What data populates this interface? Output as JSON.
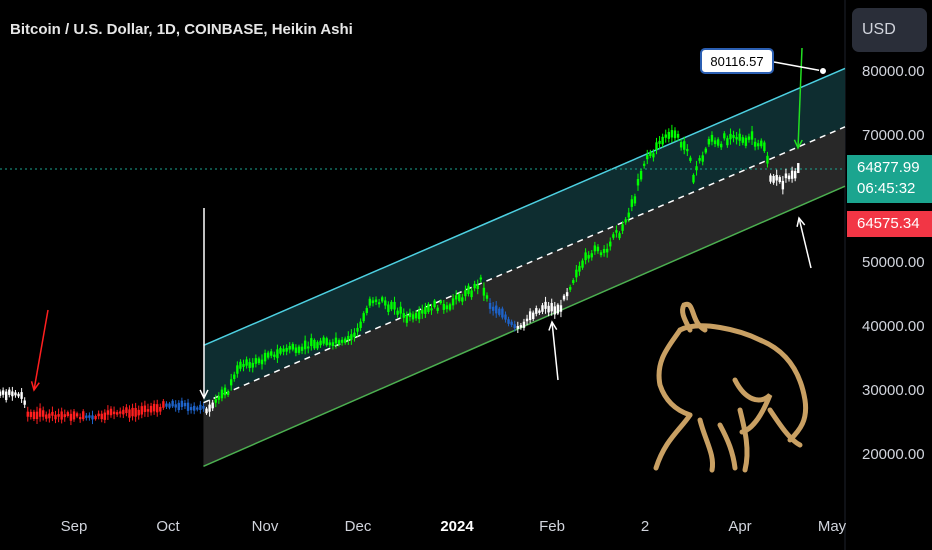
{
  "header": {
    "title": "Bitcoin / U.S. Dollar, 1D, COINBASE, Heikin Ashi",
    "currency_label": "USD"
  },
  "price_scale": {
    "ticks": [
      "80000.00",
      "70000.00",
      "50000.00",
      "40000.00",
      "30000.00",
      "20000.00"
    ],
    "current_price": "64877.99",
    "countdown": "06:45:32",
    "lower_price": "64575.34"
  },
  "time_axis": {
    "labels": [
      "Sep",
      "Oct",
      "Nov",
      "Dec",
      "2024",
      "Feb",
      "2",
      "Apr",
      "May"
    ]
  },
  "annotation": {
    "target_value": "80116.57"
  },
  "colors": {
    "background": "#000000",
    "channel_upper": "#4dd0e1",
    "channel_lower": "#4caf50",
    "channel_mid": "#ffffff",
    "candle_green": "#00ff00",
    "candle_white": "#ffffff",
    "candle_red": "#ff1f1f",
    "candle_blue": "#1e63c9",
    "current_price_bg": "#1ba58f",
    "lower_price_bg": "#f23645",
    "logo_gold": "#c9a063"
  },
  "chart_data": {
    "type": "line",
    "y_scale_units": "USD",
    "ylim": [
      17000,
      88000
    ],
    "x_range": [
      "2023-07-27",
      "2024-05-15"
    ],
    "channel": {
      "start": "2023-10-13",
      "end": "2024-05-15",
      "upper": [
        37000,
        82000
      ],
      "mid": [
        28000,
        72800
      ],
      "lower": [
        18000,
        63500
      ]
    },
    "series": [
      {
        "points": [
          [
            "2023-07-27",
            29300,
            "white"
          ],
          [
            "2023-08-10",
            29400,
            "white"
          ],
          [
            "2023-08-15",
            29200,
            "white"
          ],
          [
            "2023-08-17",
            26200,
            "red"
          ],
          [
            "2023-08-25",
            26100,
            "red"
          ],
          [
            "2023-09-01",
            25900,
            "red"
          ],
          [
            "2023-09-05",
            25800,
            "blue"
          ],
          [
            "2023-09-08",
            25900,
            "red"
          ],
          [
            "2023-09-15",
            26600,
            "red"
          ],
          [
            "2023-09-22",
            26500,
            "red"
          ],
          [
            "2023-10-01",
            27500,
            "blue"
          ],
          [
            "2023-10-05",
            27600,
            "blue"
          ],
          [
            "2023-10-10",
            27300,
            "blue"
          ],
          [
            "2023-10-14",
            26900,
            "white"
          ],
          [
            "2023-10-17",
            28400,
            "green"
          ],
          [
            "2023-10-21",
            29800,
            "green"
          ],
          [
            "2023-10-24",
            33500,
            "green"
          ],
          [
            "2023-10-31",
            34500,
            "green"
          ],
          [
            "2023-11-09",
            36500,
            "green"
          ],
          [
            "2023-11-16",
            37000,
            "green"
          ],
          [
            "2023-11-23",
            37500,
            "green"
          ],
          [
            "2023-12-01",
            38500,
            "green"
          ],
          [
            "2023-12-06",
            43500,
            "green"
          ],
          [
            "2023-12-10",
            44000,
            "green"
          ],
          [
            "2023-12-18",
            41500,
            "green"
          ],
          [
            "2023-12-25",
            43000,
            "green"
          ],
          [
            "2024-01-01",
            43500,
            "green"
          ],
          [
            "2024-01-08",
            45500,
            "green"
          ],
          [
            "2024-01-11",
            47000,
            "green"
          ],
          [
            "2024-01-14",
            43000,
            "blue"
          ],
          [
            "2024-01-19",
            41500,
            "blue"
          ],
          [
            "2024-01-23",
            40000,
            "white"
          ],
          [
            "2024-01-26",
            41000,
            "white"
          ],
          [
            "2024-02-01",
            43000,
            "white"
          ],
          [
            "2024-02-05",
            42500,
            "white"
          ],
          [
            "2024-02-09",
            45500,
            "green"
          ],
          [
            "2024-02-14",
            51500,
            "green"
          ],
          [
            "2024-02-20",
            52000,
            "green"
          ],
          [
            "2024-02-27",
            56000,
            "green"
          ],
          [
            "2024-03-02",
            62000,
            "green"
          ],
          [
            "2024-03-05",
            66500,
            "green"
          ],
          [
            "2024-03-08",
            68000,
            "green"
          ],
          [
            "2024-03-13",
            71000,
            "green"
          ],
          [
            "2024-03-17",
            68500,
            "green"
          ],
          [
            "2024-03-20",
            64000,
            "green"
          ],
          [
            "2024-03-26",
            69500,
            "green"
          ],
          [
            "2024-04-01",
            69000,
            "green"
          ],
          [
            "2024-04-08",
            70000,
            "green"
          ],
          [
            "2024-04-12",
            68000,
            "green"
          ],
          [
            "2024-04-14",
            64000,
            "white"
          ],
          [
            "2024-04-17",
            62500,
            "white"
          ],
          [
            "2024-04-20",
            63500,
            "white"
          ],
          [
            "2024-04-23",
            64900,
            "white"
          ]
        ]
      }
    ]
  }
}
